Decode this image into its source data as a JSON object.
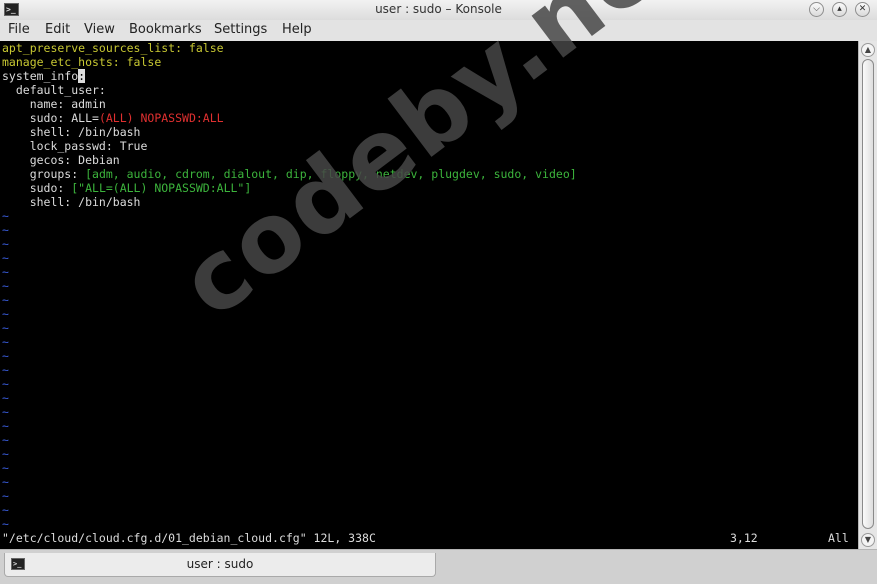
{
  "window": {
    "title": "user : sudo – Konsole",
    "app_icon": "terminal-icon",
    "controls": [
      "minimize-icon",
      "maximize-icon",
      "close-icon"
    ]
  },
  "menu": [
    "File",
    "Edit",
    "View",
    "Bookmarks",
    "Settings",
    "Help"
  ],
  "editor": {
    "tilde": "~",
    "tilde_count": 23,
    "colors": {
      "key": "#c8c832",
      "string": "#e03030",
      "list": "#3cb43c",
      "tilde": "#3a5ddc",
      "text": "#dcdcdc",
      "background": "#000000"
    },
    "lines": [
      [
        {
          "t": "apt_preserve_sources_list: false",
          "c": "ck"
        }
      ],
      [
        {
          "t": "manage_etc_hosts: false",
          "c": "ck"
        }
      ],
      [
        {
          "t": "system_info"
        },
        {
          "t": ":",
          "c": "cursor"
        }
      ],
      [
        {
          "t": "  default_user:"
        }
      ],
      [
        {
          "t": "    name: admin"
        }
      ],
      [
        {
          "t": "    sudo: ALL="
        },
        {
          "t": "(ALL) NOPASSWD:ALL",
          "c": "cr"
        }
      ],
      [
        {
          "t": "    shell: /bin/bash"
        }
      ],
      [
        {
          "t": "    lock_passwd: True"
        }
      ],
      [
        {
          "t": "    gecos: Debian"
        }
      ],
      [
        {
          "t": "    groups: "
        },
        {
          "t": "[adm, audio, cdrom, dialout, dip, floppy, netdev, plugdev, sudo, video]",
          "c": "cg"
        }
      ],
      [
        {
          "t": "    sudo: "
        },
        {
          "t": "[\"ALL=(ALL) NOPASSWD:ALL\"]",
          "c": "cg"
        }
      ],
      [
        {
          "t": "    shell: /bin/bash"
        }
      ]
    ],
    "status": {
      "file": "\"/etc/cloud/cloud.cfg.d/01_debian_cloud.cfg\" 12L, 338C",
      "position": "3,12",
      "scroll": "All"
    }
  },
  "watermark": "codeby.net",
  "tab": {
    "label": "user : sudo",
    "icon": "terminal-icon"
  }
}
